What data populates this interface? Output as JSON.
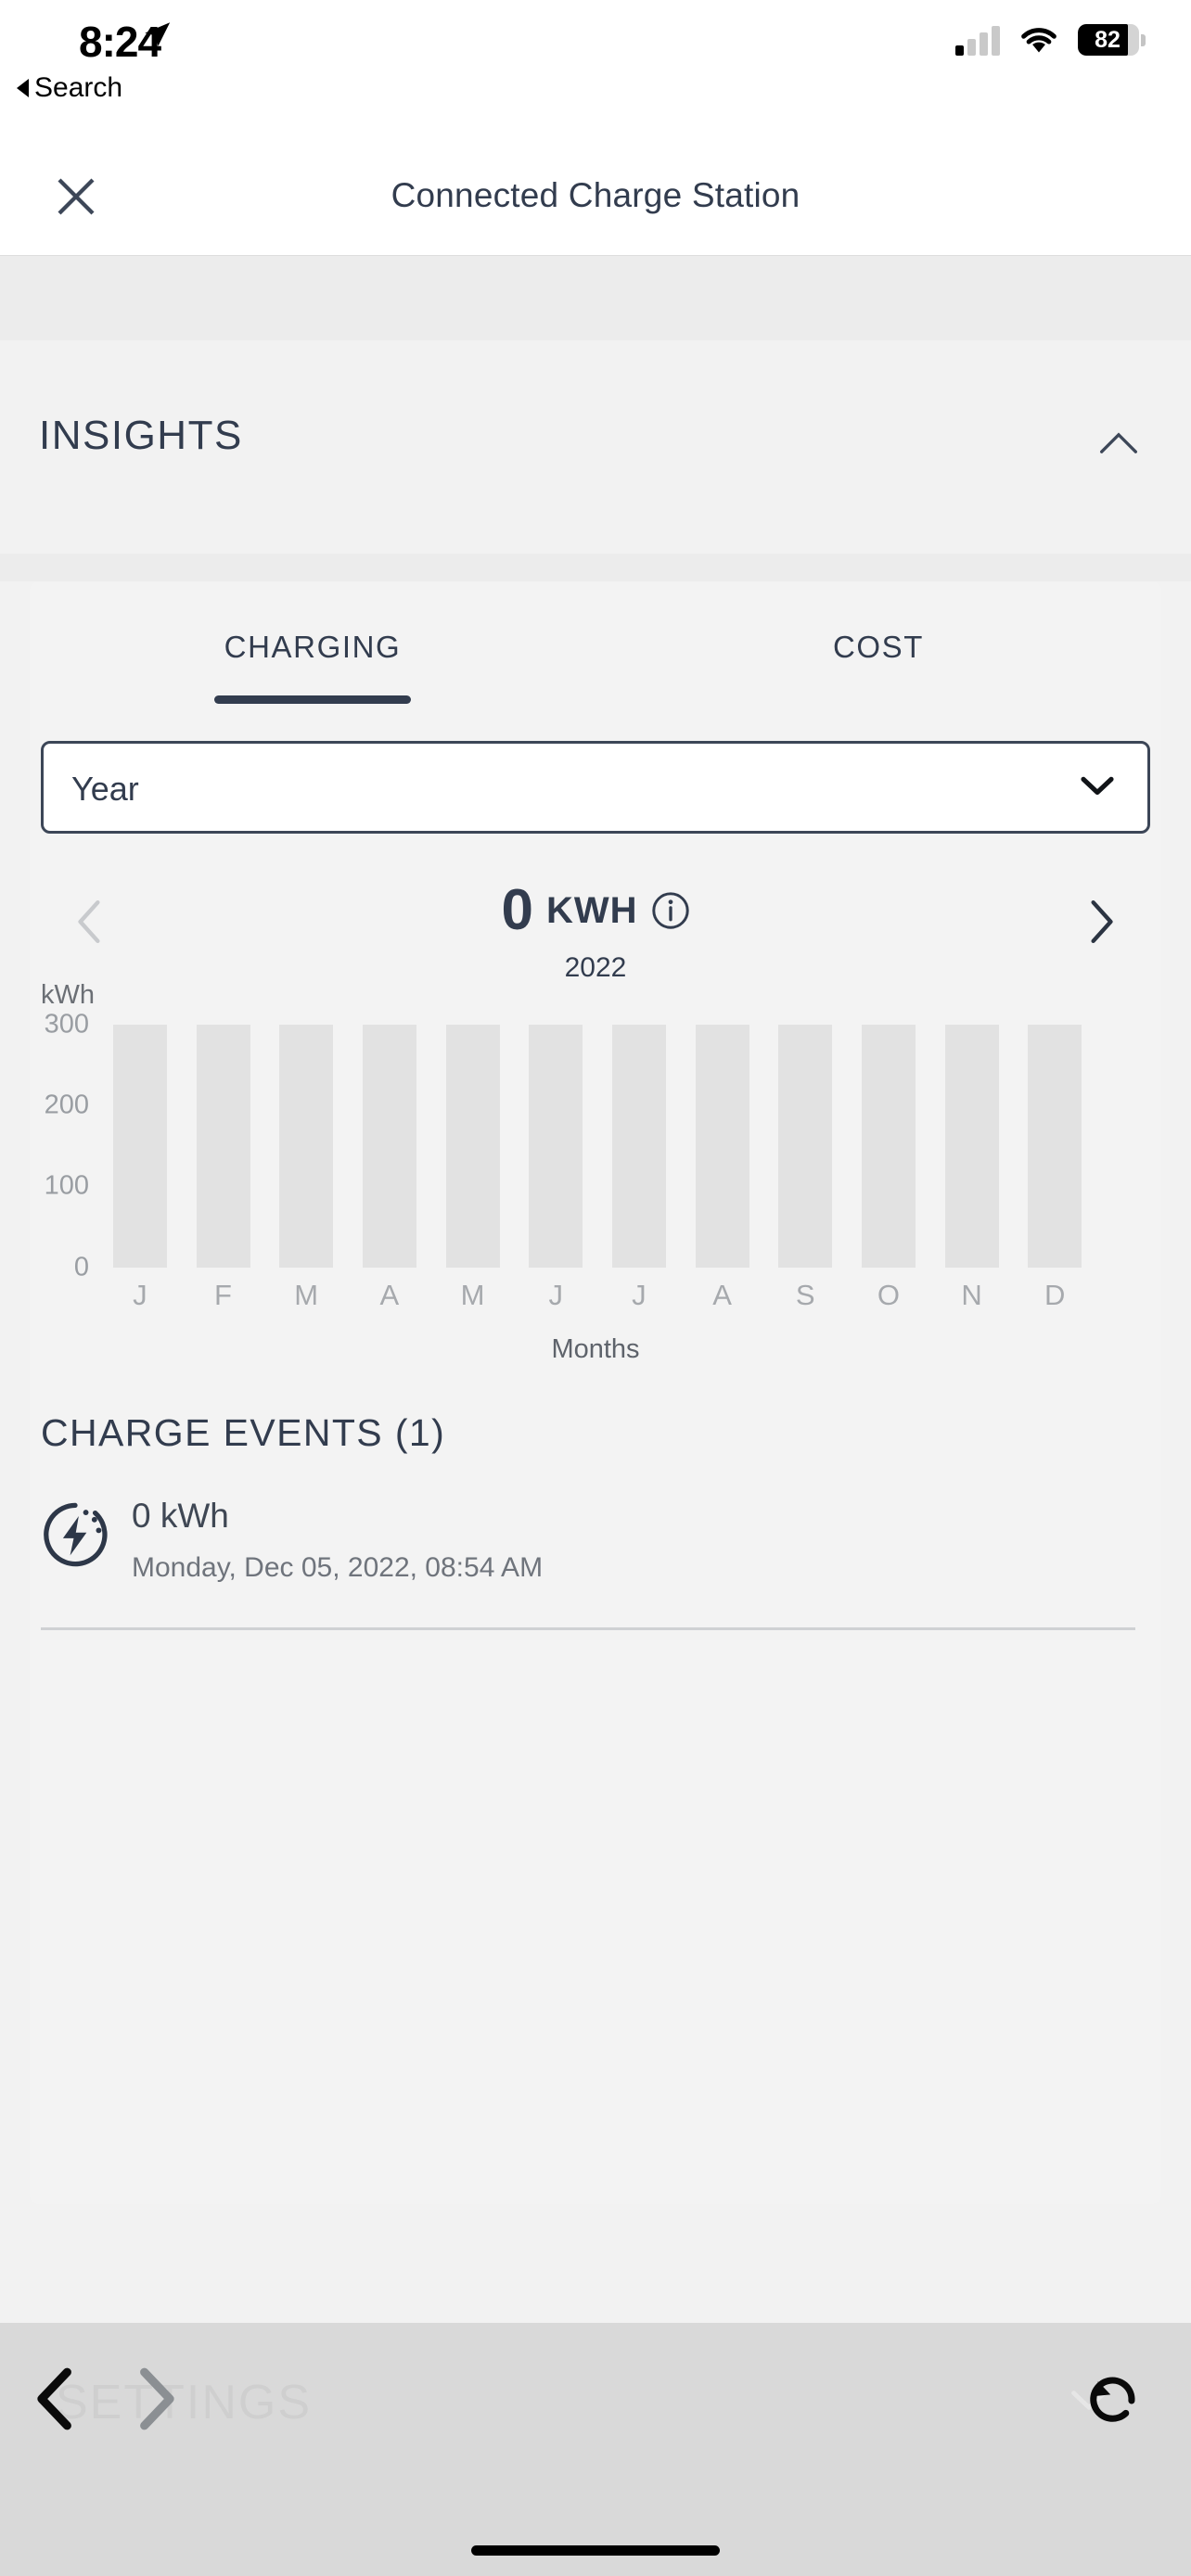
{
  "status_bar": {
    "time": "8:24",
    "back_label": "Search",
    "battery_level": "82",
    "location_icon": "location-arrow-icon",
    "wifi_icon": "wifi-icon",
    "signal_icon": "cellular-signal-icon",
    "battery_icon": "battery-icon"
  },
  "navbar": {
    "title": "Connected Charge Station",
    "close_icon": "close-icon"
  },
  "insights": {
    "title": "INSIGHTS",
    "collapse_icon": "chevron-up-icon"
  },
  "tabs": [
    {
      "label": "CHARGING",
      "active": true
    },
    {
      "label": "COST",
      "active": false
    }
  ],
  "period_select": {
    "value": "Year",
    "caret_icon": "chevron-down-icon"
  },
  "summary": {
    "value": "0",
    "unit": "KWH",
    "info_icon": "info-circle-icon",
    "prev_icon": "chevron-left-icon",
    "next_icon": "chevron-right-icon",
    "period": "2022"
  },
  "chart_data": {
    "type": "bar",
    "title": "",
    "categories": [
      "J",
      "F",
      "M",
      "A",
      "M",
      "J",
      "J",
      "A",
      "S",
      "O",
      "N",
      "D"
    ],
    "values": [
      0,
      0,
      0,
      0,
      0,
      0,
      0,
      0,
      0,
      0,
      0,
      0
    ],
    "placeholder_values": [
      300,
      300,
      300,
      300,
      300,
      300,
      300,
      300,
      300,
      300,
      300,
      300
    ],
    "xlabel": "Months",
    "ylabel": "kWh",
    "yticks": [
      "300",
      "200",
      "100",
      "0"
    ],
    "ylim": [
      0,
      300
    ],
    "grid": false,
    "legend": "none",
    "note": "All bars are empty placeholders rendered at full height in light gray; no data for 2022."
  },
  "charge_events": {
    "title": "CHARGE EVENTS (1)",
    "items": [
      {
        "icon": "charge-bolt-icon",
        "energy": "0 kWh",
        "timestamp": "Monday, Dec 05, 2022, 08:54 AM"
      }
    ]
  },
  "browser_bar": {
    "ghost_label": "SETTINGS",
    "back_icon": "chevron-left-icon",
    "forward_icon": "chevron-right-icon",
    "reload_icon": "reload-icon"
  },
  "colors": {
    "accent": "#323c4e",
    "page_bg": "#f2f2f2",
    "card_bg": "#f3f3f3",
    "bar_gray": "#e2e2e2",
    "browser_bar_bg": "#d9d9d9"
  }
}
